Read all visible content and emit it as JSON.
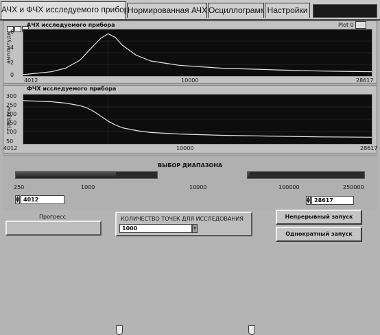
{
  "tabs": [
    {
      "label": "АЧХ и ФЧХ исследуемого прибора",
      "active": true
    },
    {
      "label": "Нормированная АЧХ",
      "active": false
    },
    {
      "label": "Осциллограммы",
      "active": false
    },
    {
      "label": "Настройки",
      "active": false
    }
  ],
  "amp_graph": {
    "title": "АЧХ исследуемого прибора",
    "ylabel": "амплитуда",
    "legend": "Plot 0",
    "x_ticks": [
      "4012",
      "10000",
      "28617"
    ],
    "y_ticks": [
      "6",
      "4",
      "2",
      "0"
    ]
  },
  "phase_graph": {
    "title": "ФЧХ исследуемого прибора",
    "ylabel": "градусы",
    "x_ticks": [
      "4012",
      "10000",
      "28617"
    ],
    "y_ticks": [
      "300",
      "250",
      "200",
      "150",
      "100",
      "50"
    ]
  },
  "range": {
    "title": "ВЫБОР ДИАПАЗОНА",
    "left_scale": [
      "250",
      "1000",
      "10000"
    ],
    "right_scale": [
      "100000",
      "250000"
    ],
    "min_value": "4012",
    "max_value": "28617",
    "min_slider_fraction": 0.71,
    "max_slider_fraction": 0.02
  },
  "progress": {
    "label": "Прогресс",
    "value": 0
  },
  "points": {
    "label": "КОЛИЧЕСТВО ТОЧЕК ДЛЯ ИССЛЕДОВАНИЯ",
    "value": "1000"
  },
  "buttons": {
    "continuous": "Непрерывный запуск",
    "single": "Однократный запуск"
  },
  "chart_data": [
    {
      "type": "line",
      "title": "АЧХ исследуемого прибора",
      "ylabel": "амплитуда",
      "xlim": [
        4012,
        28617
      ],
      "ylim": [
        0,
        6.5
      ],
      "grid": true,
      "series": [
        {
          "name": "Plot 0",
          "x": [
            4012,
            6000,
            7000,
            8000,
            9000,
            9500,
            10000,
            10500,
            11000,
            12000,
            13000,
            15000,
            18000,
            22000,
            25000,
            28617
          ],
          "y": [
            0.2,
            0.6,
            1.1,
            2.2,
            4.3,
            5.3,
            5.9,
            5.4,
            4.3,
            2.9,
            2.1,
            1.5,
            1.1,
            0.85,
            0.7,
            0.6
          ]
        }
      ]
    },
    {
      "type": "line",
      "title": "ФЧХ исследуемого прибора",
      "ylabel": "градусы",
      "xlim": [
        4012,
        28617
      ],
      "ylim": [
        40,
        300
      ],
      "grid": true,
      "series": [
        {
          "x": [
            4012,
            6000,
            7000,
            8000,
            8500,
            9000,
            9500,
            10000,
            10500,
            11000,
            12000,
            13000,
            15000,
            18000,
            22000,
            25000,
            28617
          ],
          "y": [
            268,
            262,
            255,
            242,
            230,
            210,
            185,
            160,
            140,
            125,
            110,
            100,
            92,
            85,
            80,
            77,
            75
          ]
        }
      ]
    }
  ]
}
